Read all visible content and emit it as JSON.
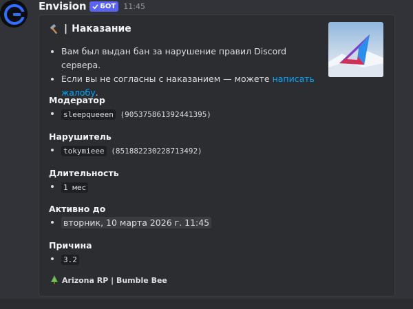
{
  "author": {
    "name": "Envision",
    "badge": "БОТ",
    "time": "11:45"
  },
  "embed": {
    "title": "Наказание",
    "title_icon": "hammer-icon",
    "thumbnail": "arizona-logo-image",
    "description": {
      "line1": "Вам был выдан бан за нарушение правил Discord сервера.",
      "line2_prefix": "Если вы не согласны с наказанием — можете ",
      "line2_link": "написать жалобу",
      "line2_suffix": "."
    },
    "fields": [
      {
        "name": "Модератор",
        "code": "sleepqueeen",
        "extra": " (905375861392441395)"
      },
      {
        "name": "Нарушитель",
        "code": "tokymieee",
        "extra": " (851882230228713492)"
      },
      {
        "name": "Длительность",
        "code": "1 мес"
      },
      {
        "name": "Активно до",
        "value": "вторник, 10 марта 2026 г. 11:45"
      },
      {
        "name": "Причина",
        "code": "3.2"
      }
    ],
    "footer": "Arizona RP | Bumble Bee",
    "footer_icon": "tree-icon",
    "accent": "#5865f2",
    "link_color": "#00a8fc"
  }
}
